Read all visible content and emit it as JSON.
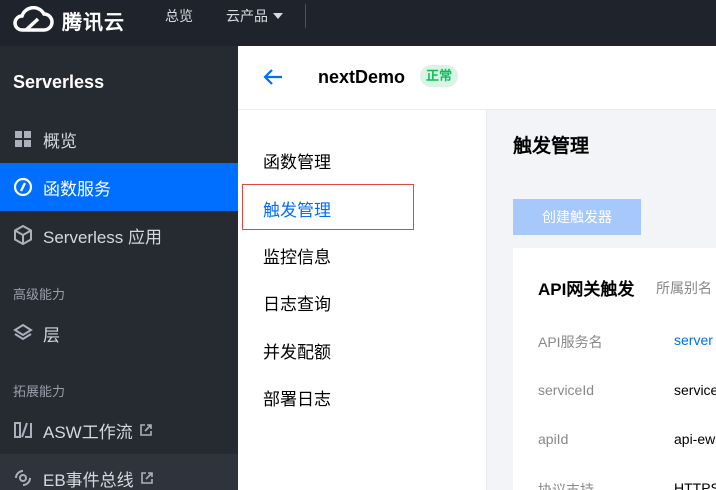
{
  "topbar": {
    "brand": "腾讯云",
    "nav_overview": "总览",
    "nav_products": "云产品"
  },
  "sidebar": {
    "title": "Serverless",
    "items": [
      {
        "label": "概览",
        "icon": "grid-icon"
      },
      {
        "label": "函数服务",
        "icon": "function-icon"
      },
      {
        "label": "Serverless 应用",
        "icon": "cube-icon"
      }
    ],
    "section_advanced": "高级能力",
    "advanced_items": [
      {
        "label": "层",
        "icon": "layers-icon"
      }
    ],
    "section_extend": "拓展能力",
    "extend_items": [
      {
        "label": "ASW工作流",
        "icon": "workflow-icon"
      },
      {
        "label": "EB事件总线",
        "icon": "eventbus-icon"
      }
    ]
  },
  "header": {
    "function_name": "nextDemo",
    "status": "正常"
  },
  "submenu": {
    "items": [
      "函数管理",
      "触发管理",
      "监控信息",
      "日志查询",
      "并发配额",
      "部署日志"
    ],
    "active": "触发管理"
  },
  "content": {
    "title": "触发管理",
    "create_button": "创建触发器",
    "card": {
      "title": "API网关触发",
      "subtitle": "所属别名",
      "rows": [
        {
          "label": "API服务名",
          "value": "server"
        },
        {
          "label": "serviceId",
          "value": "service"
        },
        {
          "label": "apiId",
          "value": "api-ew"
        },
        {
          "label": "协议支持",
          "value": "HTTPS"
        }
      ]
    }
  },
  "colors": {
    "accent": "#006eff",
    "topbar": "#1f242c",
    "sidebar": "#262a31",
    "status_green": "#0abf5b",
    "highlight_red": "#e54545"
  }
}
